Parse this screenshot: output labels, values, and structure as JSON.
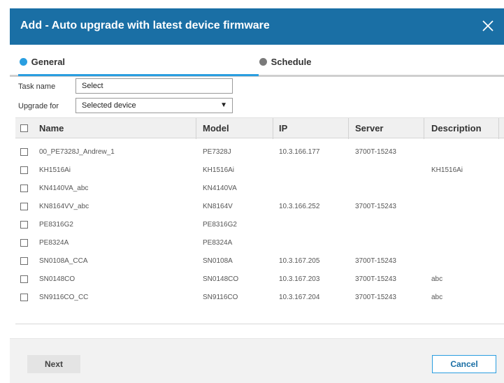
{
  "dialog": {
    "title": "Add - Auto upgrade with latest device firmware",
    "close_icon": "close-icon"
  },
  "tabs": [
    {
      "label": "General",
      "active": true,
      "icon": "step-dot-icon"
    },
    {
      "label": "Schedule",
      "active": false,
      "icon": "step-dot-icon"
    }
  ],
  "form": {
    "task_name_label": "Task name",
    "task_name_value": "Select",
    "upgrade_for_label": "Upgrade for",
    "upgrade_for_value": "Selected device"
  },
  "table": {
    "columns": [
      "Name",
      "Model",
      "IP",
      "Server",
      "Description"
    ],
    "rows": [
      {
        "name": "00_PE7328J_Andrew_1",
        "model": "PE7328J",
        "ip": "10.3.166.177",
        "server": "3700T-15243",
        "description": ""
      },
      {
        "name": "KH1516Ai",
        "model": "KH1516Ai",
        "ip": "",
        "server": "",
        "description": "KH1516Ai"
      },
      {
        "name": "KN4140VA_abc",
        "model": "KN4140VA",
        "ip": "",
        "server": "",
        "description": ""
      },
      {
        "name": "KN8164VV_abc",
        "model": "KN8164V",
        "ip": "10.3.166.252",
        "server": "3700T-15243",
        "description": ""
      },
      {
        "name": "PE8316G2",
        "model": "PE8316G2",
        "ip": "",
        "server": "",
        "description": ""
      },
      {
        "name": "PE8324A",
        "model": "PE8324A",
        "ip": "",
        "server": "",
        "description": ""
      },
      {
        "name": "SN0108A_CCA",
        "model": "SN0108A",
        "ip": "10.3.167.205",
        "server": "3700T-15243",
        "description": ""
      },
      {
        "name": "SN0148CO",
        "model": "SN0148CO",
        "ip": "10.3.167.203",
        "server": "3700T-15243",
        "description": "abc"
      },
      {
        "name": "SN9116CO_CC",
        "model": "SN9116CO",
        "ip": "10.3.167.204",
        "server": "3700T-15243",
        "description": "abc"
      }
    ]
  },
  "footer": {
    "next_label": "Next",
    "cancel_label": "Cancel"
  },
  "colors": {
    "titlebar": "#1a6fa5",
    "accent": "#2a9ee0"
  }
}
